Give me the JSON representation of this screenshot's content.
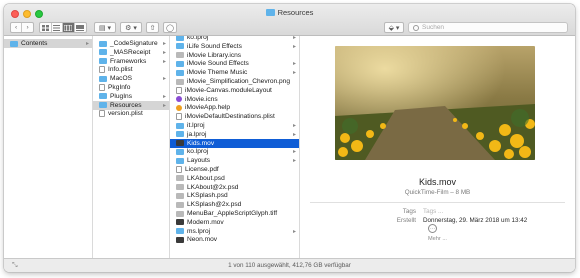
{
  "window": {
    "title": "Resources"
  },
  "toolbar": {
    "back_glyph": "‹",
    "forward_glyph": "›",
    "view_icons": [
      "grid-icon",
      "list-icon",
      "columns-icon",
      "gallery-icon"
    ],
    "group_glyph": "▤ ▾",
    "action_glyph": "⚙ ▾",
    "share_glyph": "⇧",
    "tag_glyph": "◯",
    "dropbox_glyph": "⬙ ▾",
    "search_placeholder": "Suchen"
  },
  "col1": [
    {
      "label": "Contents",
      "icon": "folder",
      "selected": "grey",
      "chevron": true
    }
  ],
  "col2": [
    {
      "label": "_CodeSignature",
      "icon": "folder",
      "chevron": true
    },
    {
      "label": "_MASReceipt",
      "icon": "folder",
      "chevron": true
    },
    {
      "label": "Frameworks",
      "icon": "folder",
      "chevron": true
    },
    {
      "label": "Info.plist",
      "icon": "doc",
      "chevron": false
    },
    {
      "label": "MacOS",
      "icon": "folder",
      "chevron": true
    },
    {
      "label": "PkgInfo",
      "icon": "doc",
      "chevron": false
    },
    {
      "label": "PlugIns",
      "icon": "folder",
      "chevron": true
    },
    {
      "label": "Resources",
      "icon": "folder",
      "chevron": true,
      "selected": "grey"
    },
    {
      "label": "version.plist",
      "icon": "doc",
      "chevron": false
    }
  ],
  "col3": [
    {
      "label": "ko.lproj",
      "icon": "folder",
      "chevron": true
    },
    {
      "label": "iLife Sound Effects",
      "icon": "folder",
      "chevron": true
    },
    {
      "label": "iMovie Library.icns",
      "icon": "img",
      "chevron": false
    },
    {
      "label": "iMovie Sound Effects",
      "icon": "folder",
      "chevron": true
    },
    {
      "label": "iMovie Theme Music",
      "icon": "folder",
      "chevron": true
    },
    {
      "label": "iMovie_Simplification_Chevron.png",
      "icon": "img",
      "chevron": false
    },
    {
      "label": "iMovie-Canvas.moduleLayout",
      "icon": "doc",
      "chevron": false
    },
    {
      "label": "iMovie.icns",
      "icon": "star",
      "chevron": false
    },
    {
      "label": "iMovieApp.help",
      "icon": "help",
      "chevron": false
    },
    {
      "label": "iMovieDefaultDestinations.plist",
      "icon": "doc",
      "chevron": false
    },
    {
      "label": "it.lproj",
      "icon": "folder",
      "chevron": true
    },
    {
      "label": "ja.lproj",
      "icon": "folder",
      "chevron": true
    },
    {
      "label": "Kids.mov",
      "icon": "movie",
      "chevron": false,
      "selected": "blue"
    },
    {
      "label": "ko.lproj",
      "icon": "folder",
      "chevron": true
    },
    {
      "label": "Layouts",
      "icon": "folder",
      "chevron": true
    },
    {
      "label": "License.pdf",
      "icon": "doc",
      "chevron": false
    },
    {
      "label": "LKAbout.psd",
      "icon": "img",
      "chevron": false
    },
    {
      "label": "LKAbout@2x.psd",
      "icon": "img",
      "chevron": false
    },
    {
      "label": "LKSplash.psd",
      "icon": "img",
      "chevron": false
    },
    {
      "label": "LKSplash@2x.psd",
      "icon": "img",
      "chevron": false
    },
    {
      "label": "MenuBar_AppleScriptGlyph.tiff",
      "icon": "img",
      "chevron": false
    },
    {
      "label": "Modern.mov",
      "icon": "movie",
      "chevron": false
    },
    {
      "label": "ms.lproj",
      "icon": "folder",
      "chevron": true
    },
    {
      "label": "Neon.mov",
      "icon": "movie",
      "chevron": false
    }
  ],
  "preview": {
    "name": "Kids.mov",
    "kind": "QuickTime-Film – 8 MB",
    "tags_label": "Tags",
    "tags_placeholder": "Tags ...",
    "created_label": "Erstellt",
    "created_value": "Donnerstag, 29. März 2018 um 13:42",
    "more_label": "Mehr ...",
    "more_glyph": "···"
  },
  "statusbar": {
    "text": "1 von 110 ausgewählt, 412,76 GB verfügbar",
    "resize_glyph": "⤡"
  },
  "colors": {
    "selection_blue": "#0f5dd6",
    "folder": "#5fb3ea"
  }
}
